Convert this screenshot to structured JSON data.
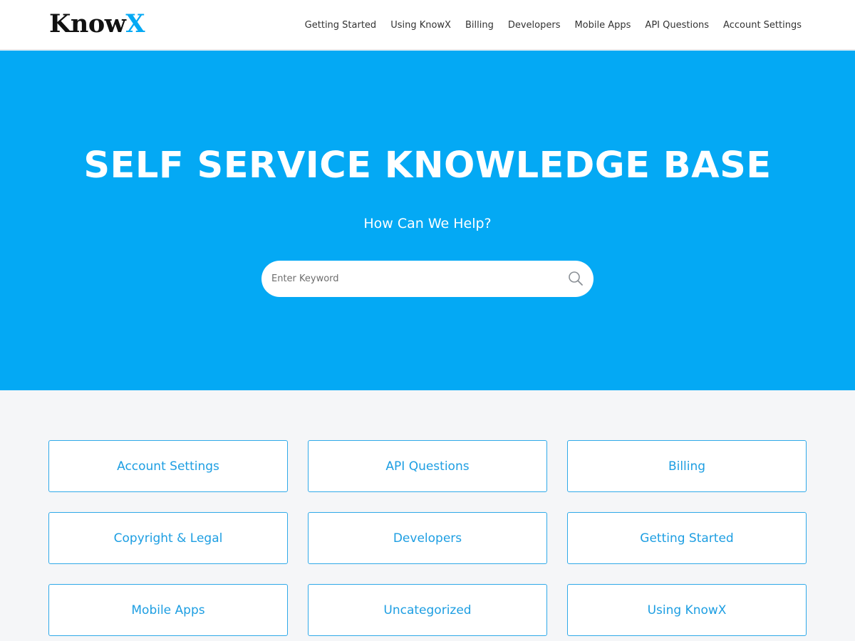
{
  "brand": {
    "logo_main": "Know",
    "logo_accent": "X",
    "accent_color": "#04a9f4"
  },
  "nav": {
    "items": [
      {
        "label": "Getting Started"
      },
      {
        "label": "Using KnowX"
      },
      {
        "label": "Billing"
      },
      {
        "label": "Developers"
      },
      {
        "label": "Mobile Apps"
      },
      {
        "label": "API Questions"
      },
      {
        "label": "Account Settings"
      }
    ]
  },
  "hero": {
    "title": "SELF SERVICE KNOWLEDGE BASE",
    "subtitle": "How Can We Help?",
    "background_color": "#04a9f4"
  },
  "search": {
    "placeholder": "Enter Keyword",
    "value": "",
    "icon": "search-icon"
  },
  "categories": [
    {
      "label": "Account Settings"
    },
    {
      "label": "API Questions"
    },
    {
      "label": "Billing"
    },
    {
      "label": "Copyright & Legal"
    },
    {
      "label": "Developers"
    },
    {
      "label": "Getting Started"
    },
    {
      "label": "Mobile Apps"
    },
    {
      "label": "Uncategorized"
    },
    {
      "label": "Using KnowX"
    }
  ]
}
